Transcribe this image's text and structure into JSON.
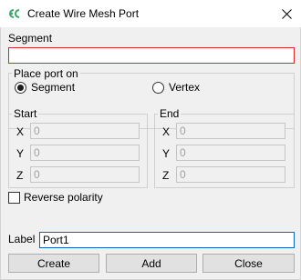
{
  "window": {
    "title": "Create Wire Mesh Port",
    "close_icon": "close-icon"
  },
  "segment": {
    "label": "Segment",
    "value": ""
  },
  "place_port": {
    "title": "Place port on",
    "options": [
      {
        "label": "Segment",
        "checked": true
      },
      {
        "label": "Vertex",
        "checked": false
      }
    ]
  },
  "start": {
    "title": "Start",
    "x_label": "X",
    "y_label": "Y",
    "z_label": "Z",
    "x": "0",
    "y": "0",
    "z": "0"
  },
  "end": {
    "title": "End",
    "x_label": "X",
    "y_label": "Y",
    "z_label": "Z",
    "x": "0",
    "y": "0",
    "z": "0"
  },
  "reverse_polarity": {
    "label": "Reverse polarity",
    "checked": false
  },
  "port_label": {
    "label": "Label",
    "value": "Port1"
  },
  "buttons": {
    "create": "Create",
    "add": "Add",
    "close": "Close"
  },
  "colors": {
    "error_border": "#d42a2a",
    "focus_border": "#0a64c8",
    "icon_green": "#3aa56a"
  }
}
